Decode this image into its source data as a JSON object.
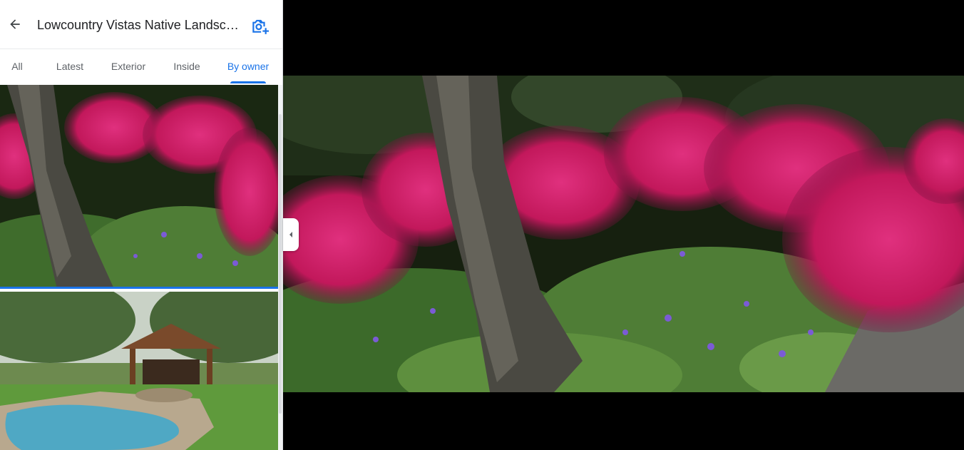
{
  "header": {
    "title": "Lowcountry Vistas Native Landscape",
    "back_icon": "arrow-left-icon",
    "add_photo_icon": "add-photo-camera-icon"
  },
  "tabs": [
    {
      "label": "All",
      "active": false
    },
    {
      "label": "Latest",
      "active": false
    },
    {
      "label": "Exterior",
      "active": false
    },
    {
      "label": "Inside",
      "active": false
    },
    {
      "label": "By owner",
      "active": true
    }
  ],
  "photos": [
    {
      "subject": "pink azalea bushes beside tree trunk",
      "selected": true
    },
    {
      "subject": "backyard pool with wooden pavilion",
      "selected": false
    }
  ],
  "viewer": {
    "collapse_icon": "chevron-left-icon"
  },
  "colors": {
    "accent": "#1a73e8",
    "text": "#202124",
    "muted": "#5f6368",
    "viewer_bg": "#000000"
  }
}
